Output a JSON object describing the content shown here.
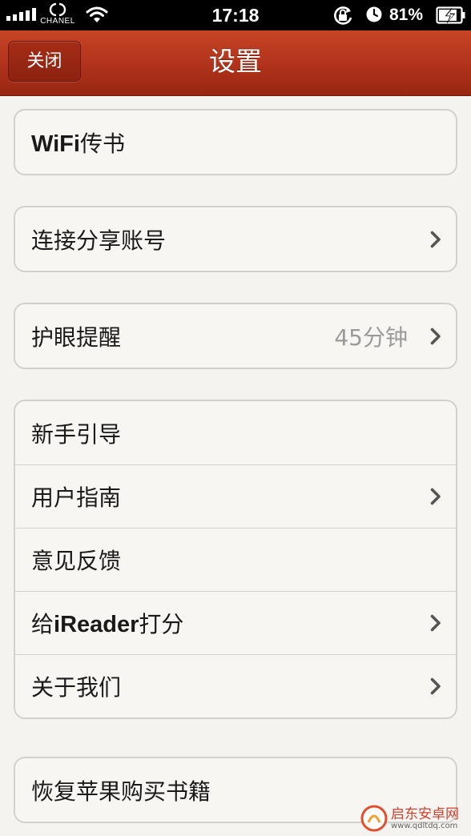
{
  "status_bar": {
    "carrier": "CHANEL",
    "time": "17:18",
    "battery_percent": "81%",
    "battery_level": 0.81,
    "signal_bars": 5
  },
  "nav": {
    "close_label": "关闭",
    "title": "设置"
  },
  "groups": [
    {
      "rows": [
        {
          "label_bold": "WiFi",
          "label": "传书",
          "value": "",
          "chevron": false
        }
      ]
    },
    {
      "rows": [
        {
          "label_bold": "",
          "label": "连接分享账号",
          "value": "",
          "chevron": true
        }
      ]
    },
    {
      "rows": [
        {
          "label_bold": "",
          "label": "护眼提醒",
          "value": "45分钟",
          "chevron": true
        }
      ]
    },
    {
      "rows": [
        {
          "label_bold": "",
          "label": "新手引导",
          "value": "",
          "chevron": false
        },
        {
          "label_bold": "",
          "label": "用户指南",
          "value": "",
          "chevron": true
        },
        {
          "label_bold": "",
          "label": "意见反馈",
          "value": "",
          "chevron": false
        },
        {
          "label_pre": "给",
          "label_bold": "iReader",
          "label": "打分",
          "value": "",
          "chevron": true
        },
        {
          "label_bold": "",
          "label": "关于我们",
          "value": "",
          "chevron": true
        }
      ]
    },
    {
      "rows": [
        {
          "label_bold": "",
          "label": "恢复苹果购买书籍",
          "value": "",
          "chevron": false
        }
      ]
    }
  ],
  "watermark": {
    "text": "启东安卓网",
    "url": "www.qdltdq.com"
  },
  "colors": {
    "nav_red": "#b0321b",
    "background": "#f4f3ef",
    "value_gray": "#9a9a9a"
  }
}
